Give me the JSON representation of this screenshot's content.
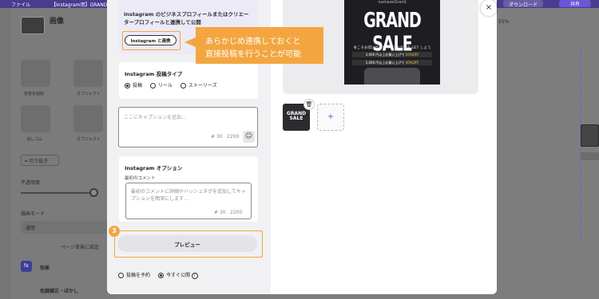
{
  "topbar": {
    "menu": "ファイル",
    "doc_title": "【Instagram用】GRAND SALE 投稿画像",
    "download": "ダウンロード",
    "share": "共有"
  },
  "sidebar": {
    "title": "画像",
    "tools": [
      "背景を削除",
      "オブジェクト",
      "消しゴム",
      "オブジェクト"
    ],
    "crop": "切り抜き",
    "opacity": "不透明度",
    "blend_mode_label": "描画モード",
    "blend_mode_value": "通常",
    "set_bg": "ページ背景に設定",
    "effects": "効果",
    "fx_icon": "fx",
    "adjust": "色調補正・ぼかし"
  },
  "editor": {
    "zoom": "55%"
  },
  "modal": {
    "connect": {
      "text": "Instagram のビジネスプロフィールまたはクリエータープロフィールと連携して公開",
      "button": "Instagram と連携"
    },
    "post_type": {
      "title": "Instagram 投稿タイプ",
      "options": [
        {
          "label": "投稿",
          "selected": true
        },
        {
          "label": "リール",
          "selected": false
        },
        {
          "label": "ストーリーズ",
          "selected": false
        }
      ]
    },
    "caption": {
      "placeholder": "ここにキャプションを追加…",
      "hashtags": "# 30",
      "chars": "2200",
      "emoji_icon": "☺"
    },
    "options": {
      "title": "Instagram オプション",
      "first_comment_label": "最初のコメント",
      "first_comment_placeholder": "最初のコメントに詳細やハッシュタグを追加してキャプションを簡潔にします…",
      "hashtags": "# 30",
      "chars": "2200"
    },
    "step_number": "3",
    "preview_button": "プレビュー",
    "publish": {
      "schedule": "投稿を予約",
      "now": "今すぐ公開",
      "now_selected": true,
      "info": "i"
    },
    "poster": {
      "top": "namaseGrand",
      "headline": "GRAND SALE",
      "line1": "冬こそお得に新しかったアイテムを GET しよう",
      "bar1_a": "3,000 円以上お買い上げで ",
      "bar1_b": "10%OFF",
      "bar2_a": "5,000 円以上お買い上げで ",
      "bar2_b": "30%OFF"
    },
    "thumb_text": "GRAND SALE",
    "trash_icon": "🗑",
    "add_icon": "+",
    "close_icon": "×"
  },
  "callout": {
    "line1": "あらかじめ連携しておくと",
    "line2": "直接投稿を行うことが可能"
  },
  "colors": {
    "accent": "#f3a640",
    "brand": "#6c55d6",
    "poster_highlight": "#f1c84c"
  }
}
